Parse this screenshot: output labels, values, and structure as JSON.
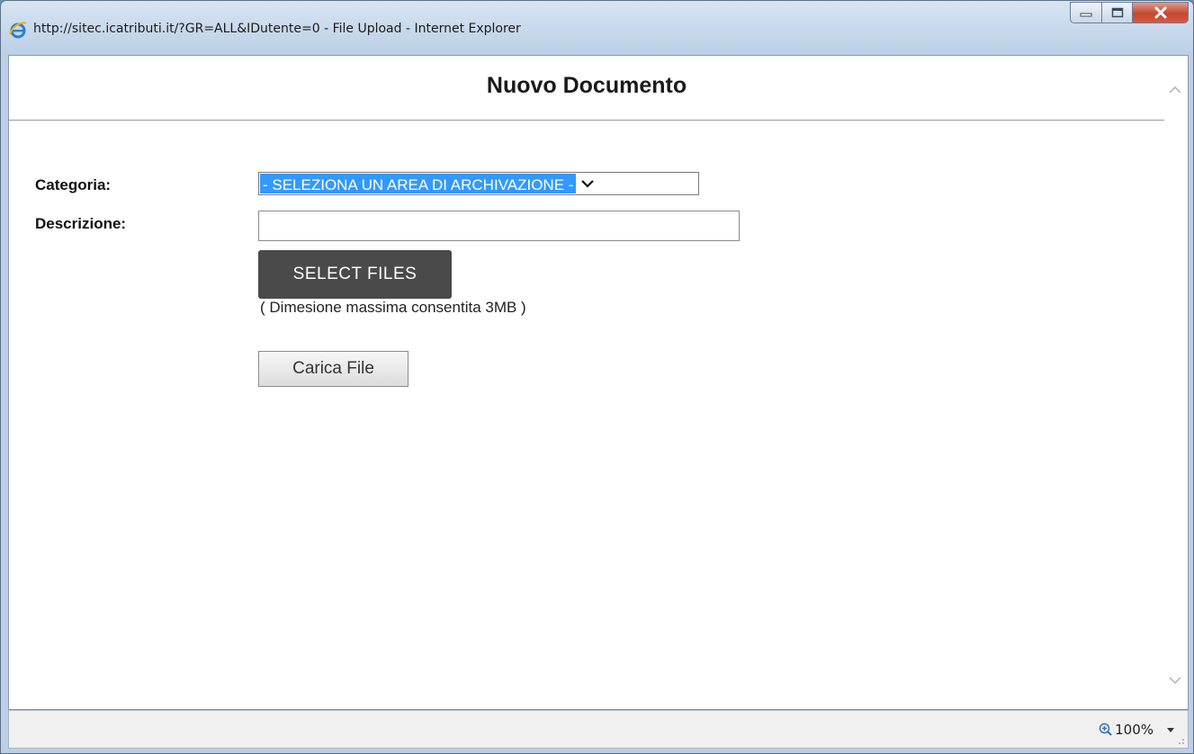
{
  "window": {
    "title": "http://sitec.icatributi.it/?GR=ALL&IDutente=0 - File Upload - Internet Explorer"
  },
  "page": {
    "title": "Nuovo Documento"
  },
  "form": {
    "category_label": "Categoria:",
    "category_selected": "- SELEZIONA UN AREA DI ARCHIVAZIONE -",
    "description_label": "Descrizione:",
    "description_value": "",
    "select_files_label": "SELECT FILES",
    "size_note": "( Dimesione massima consentita 3MB )",
    "upload_label": "Carica File"
  },
  "statusbar": {
    "zoom": "100%"
  },
  "colors": {
    "selection": "#3399ff",
    "select_files_bg": "#4a4a4a",
    "close_button": "#c6472f"
  },
  "icons": [
    "ie-logo-icon",
    "minimize-icon",
    "maximize-icon",
    "close-icon",
    "scroll-up-icon",
    "scroll-down-icon",
    "chevron-down-icon",
    "zoom-icon",
    "dropdown-arrow-icon",
    "resize-grip-icon"
  ]
}
